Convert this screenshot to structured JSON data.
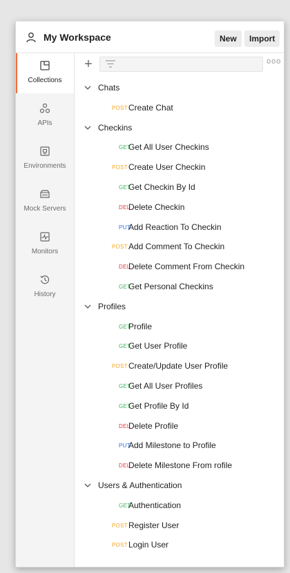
{
  "header": {
    "workspace_title": "My Workspace",
    "new_label": "New",
    "import_label": "Import"
  },
  "sidebar": {
    "items": [
      {
        "label": "Collections",
        "icon": "collections-icon",
        "active": true
      },
      {
        "label": "APIs",
        "icon": "apis-icon",
        "active": false
      },
      {
        "label": "Environments",
        "icon": "environments-icon",
        "active": false
      },
      {
        "label": "Mock Servers",
        "icon": "mock-servers-icon",
        "active": false
      },
      {
        "label": "Monitors",
        "icon": "monitors-icon",
        "active": false
      },
      {
        "label": "History",
        "icon": "history-icon",
        "active": false
      }
    ]
  },
  "toolbar": {
    "add_icon": "plus-icon",
    "filter_icon": "filter-icon",
    "more_label": "ooo"
  },
  "tree": [
    {
      "type": "folder",
      "name": "Chats"
    },
    {
      "type": "request",
      "method": "POST",
      "name": "Create Chat"
    },
    {
      "type": "folder",
      "name": "Checkins"
    },
    {
      "type": "request",
      "method": "GET",
      "name": "Get All User Checkins"
    },
    {
      "type": "request",
      "method": "POST",
      "name": "Create User Checkin"
    },
    {
      "type": "request",
      "method": "GET",
      "name": "Get Checkin By Id"
    },
    {
      "type": "request",
      "method": "DEL",
      "name": "Delete Checkin"
    },
    {
      "type": "request",
      "method": "PUT",
      "name": "Add Reaction To Checkin"
    },
    {
      "type": "request",
      "method": "POST",
      "name": "Add Comment To Checkin"
    },
    {
      "type": "request",
      "method": "DEL",
      "name": "Delete Comment From Checkin"
    },
    {
      "type": "request",
      "method": "GET",
      "name": "Get Personal Checkins"
    },
    {
      "type": "folder",
      "name": "Profiles"
    },
    {
      "type": "request",
      "method": "GET",
      "name": "Profile"
    },
    {
      "type": "request",
      "method": "GET",
      "name": "Get User Profile"
    },
    {
      "type": "request",
      "method": "POST",
      "name": "Create/Update User Profile"
    },
    {
      "type": "request",
      "method": "GET",
      "name": "Get All User Profiles"
    },
    {
      "type": "request",
      "method": "GET",
      "name": "Get Profile By Id"
    },
    {
      "type": "request",
      "method": "DEL",
      "name": "Delete Profile"
    },
    {
      "type": "request",
      "method": "PUT",
      "name": "Add Milestone to Profile"
    },
    {
      "type": "request",
      "method": "DEL",
      "name": "Delete Milestone From rofile"
    },
    {
      "type": "folder",
      "name": "Users & Authentication"
    },
    {
      "type": "request",
      "method": "GET",
      "name": "Authentication"
    },
    {
      "type": "request",
      "method": "POST",
      "name": "Register User"
    },
    {
      "type": "request",
      "method": "POST",
      "name": "Login User"
    }
  ],
  "colors": {
    "POST": "#f5a623",
    "GET": "#3bb55c",
    "DEL": "#e03b3b",
    "PUT": "#2e73e8",
    "accent": "#f26b3a"
  }
}
